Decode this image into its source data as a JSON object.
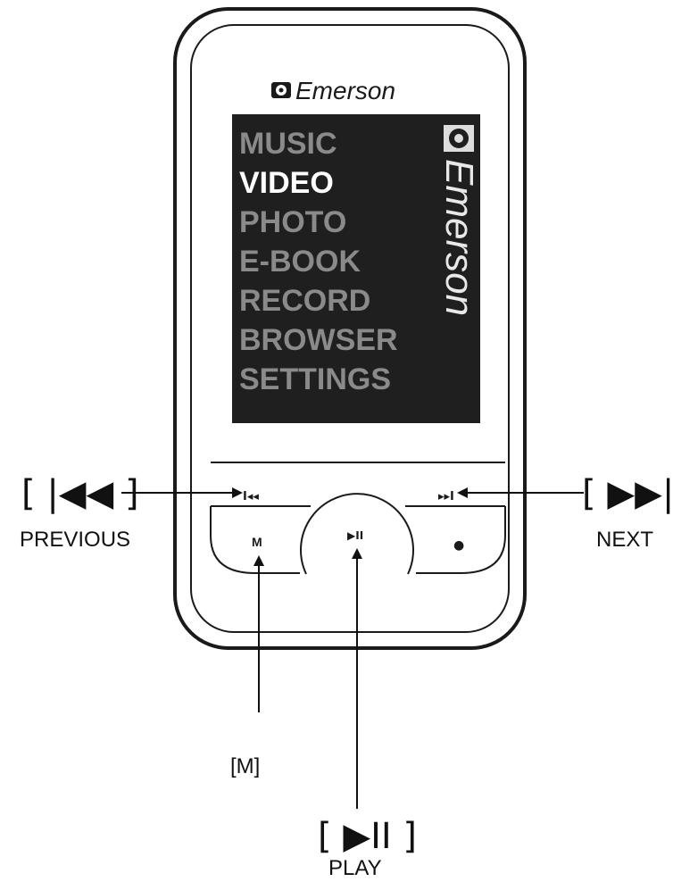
{
  "brand": {
    "name": "Emerson"
  },
  "screen": {
    "menu_items": [
      {
        "label": "MUSIC",
        "selected": false
      },
      {
        "label": "VIDEO",
        "selected": true
      },
      {
        "label": "PHOTO",
        "selected": false
      },
      {
        "label": "E-BOOK",
        "selected": false
      },
      {
        "label": "RECORD",
        "selected": false
      },
      {
        "label": "BROWSER",
        "selected": false
      },
      {
        "label": "SETTINGS",
        "selected": false
      }
    ],
    "vertical_brand": "Emerson"
  },
  "buttons": {
    "previous_glyph": "I◂◂",
    "next_glyph": "▸▸I",
    "menu_glyph": "M",
    "play_glyph": "▶II",
    "record_glyph": "●"
  },
  "callouts": {
    "previous": {
      "symbol": "[ |◀◀ ]",
      "label": "PREVIOUS"
    },
    "next": {
      "symbol": "[ ▶▶| ]",
      "label": "NEXT"
    },
    "menu": {
      "symbol": "[M]",
      "label": ""
    },
    "play": {
      "symbol": "[ ▶II ]",
      "label": "PLAY"
    }
  },
  "colors": {
    "screen_bg": "#1f1f1f",
    "menu_dim": "#8a8a8a",
    "menu_selected": "#ffffff",
    "outline": "#1a1a1a"
  }
}
